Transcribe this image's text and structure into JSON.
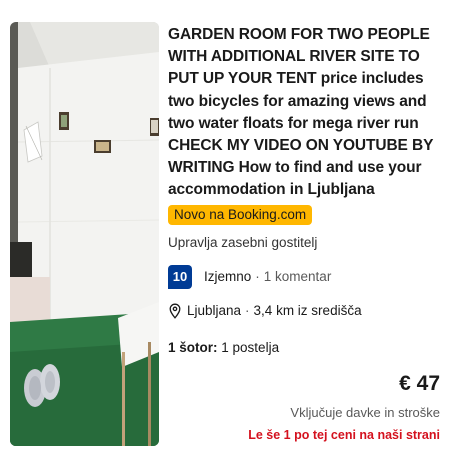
{
  "listing": {
    "title": "GARDEN ROOM FOR TWO PEOPLE WITH ADDITIONAL RIVER SITE TO PUT UP YOUR TENT price includes two bicycles for amazing views and two water floats for mega river run CHECK MY VIDEO ON YOUTUBE BY WRITING How to find and use your accommodation in Ljubljana",
    "badge": "Novo na Booking.com",
    "host": "Upravlja zasebni gostitelj",
    "rating": {
      "score": "10",
      "word": "Izjemno",
      "separator": "·",
      "reviews": "1 komentar"
    },
    "location": {
      "icon": "map-pin-icon",
      "city": "Ljubljana",
      "separator": "·",
      "distance": "3,4 km iz središča"
    },
    "room": {
      "label": "1 šotor:",
      "detail": "1 postelja"
    },
    "price": "€ 47",
    "taxes_note": "Vključuje davke in stroške",
    "urgency": "Le še 1 po tej ceni na naši strani"
  },
  "colors": {
    "badge": "#ffb700",
    "score_bg": "#003b95",
    "urgency": "#d4111e"
  }
}
